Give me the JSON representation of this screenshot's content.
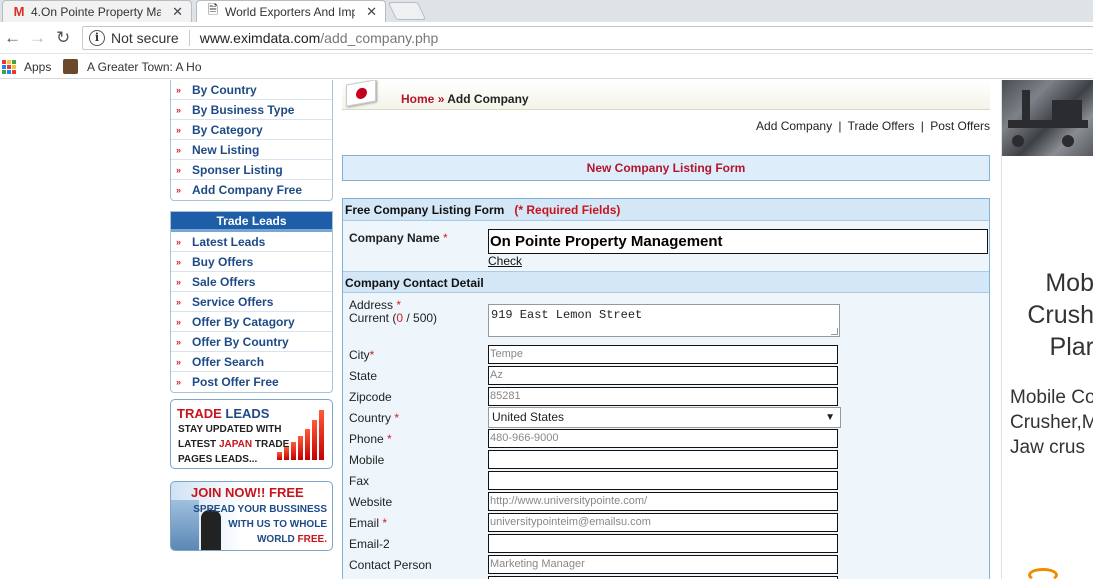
{
  "browser": {
    "tabs": [
      {
        "title": "4.On Pointe Property Ma",
        "icon": "gmail-icon",
        "close": "✕"
      },
      {
        "title": "World Exporters And Imp",
        "icon": "page-icon",
        "close": "✕"
      }
    ],
    "security": "Not secure",
    "url_host": "www.eximdata.com",
    "url_path": "/add_company.php",
    "bookmarks": [
      {
        "label": "Apps"
      },
      {
        "label": "A Greater Town: A Ho"
      }
    ]
  },
  "sidebar": {
    "browse_items": [
      "By Country",
      "By Business Type",
      "By Category",
      "New Listing",
      "Sponser Listing",
      "Add Company Free"
    ],
    "trade_leads_title": "Trade Leads",
    "trade_items": [
      "Latest Leads",
      "Buy Offers",
      "Sale Offers",
      "Service Offers",
      "Offer By Catagory",
      "Offer By Country",
      "Offer Search",
      "Post Offer Free"
    ],
    "banner1": {
      "title_a": "TRADE",
      "title_b": "LEADS",
      "line1": "STAY UPDATED WITH",
      "line2a": "LATEST",
      "line2b": "JAPAN",
      "line2c": "TRADE",
      "line3": "PAGES LEADS..."
    },
    "banner2": {
      "title_a": "JOIN NOW!!",
      "title_b": "FREE",
      "line1": "SPREAD YOUR BUSSINESS",
      "line2": "WITH US TO WHOLE",
      "line3a": "WORLD",
      "line3b": "FREE."
    }
  },
  "breadcrumb": {
    "home": "Home",
    "sep": "»",
    "current": "Add Company"
  },
  "toplinks": [
    "Add Company",
    "Trade Offers",
    "Post Offers"
  ],
  "form_title": "New Company Listing Form",
  "form": {
    "section_free": "Free Company Listing Form",
    "required_note": "(* Required Fields)",
    "company_name_label": "Company Name",
    "company_name_value": "On Pointe Property Management",
    "check_link": "Check",
    "section_contact": "Company Contact Detail",
    "address_label": "Address",
    "current_label": "Current (",
    "current_count": "0",
    "current_max": " / 500)",
    "address_value": "919 East Lemon Street",
    "fields": [
      {
        "label": "City",
        "required": true,
        "value": "Tempe"
      },
      {
        "label": "State",
        "required": false,
        "value": "Az"
      },
      {
        "label": "Zipcode",
        "required": false,
        "value": "85281"
      },
      {
        "label": "Country",
        "required": true,
        "value": "United States",
        "select": true
      },
      {
        "label": "Phone",
        "required": true,
        "value": "480-966-9000"
      },
      {
        "label": "Mobile",
        "required": false,
        "value": ""
      },
      {
        "label": "Fax",
        "required": false,
        "value": ""
      },
      {
        "label": "Website",
        "required": false,
        "value": "http://www.universitypointe.com/"
      },
      {
        "label": "Email",
        "required": true,
        "value": "universitypointeim@emailsu.com"
      },
      {
        "label": "Email-2",
        "required": false,
        "value": ""
      },
      {
        "label": "Contact Person",
        "required": false,
        "value": "Marketing Manager"
      }
    ]
  },
  "ad": {
    "big_lines": [
      "Mob",
      "Crush",
      "Plar"
    ],
    "small_lines": [
      "Mobile Co",
      "Crusher,M",
      "Jaw crus"
    ]
  }
}
